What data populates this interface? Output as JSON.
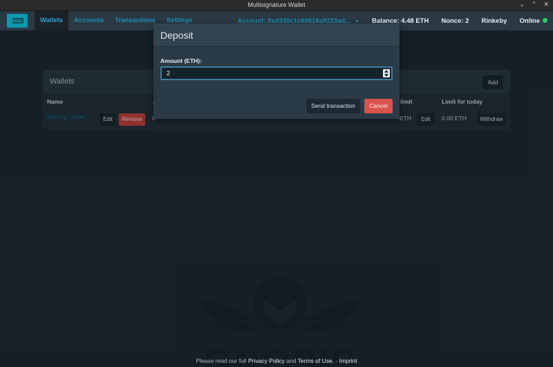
{
  "window": {
    "title": "Multisignature Wallet"
  },
  "navbar": {
    "tabs": [
      "Wallets",
      "Accounts",
      "Transactions",
      "Settings"
    ],
    "active_tab": "Wallets",
    "account": "Account: 0xd330c1c69818a9223ad...",
    "balance": "Balance: 4.48 ETH",
    "nonce": "Nonce: 2",
    "network": "Rinkeby",
    "status": "Online"
  },
  "wallets_panel": {
    "title": "Wallets",
    "add_label": "Add",
    "columns": {
      "name": "Name",
      "address": "A",
      "limit": "limit",
      "limit_today": "Limit for today"
    },
    "row": {
      "name": "Multisig_wallet",
      "edit_label": "Edit",
      "remove_label": "Remove",
      "address_fragment": "0",
      "limit_value": "ETH",
      "limit_edit_label": "Edit",
      "limit_today": "0.00 ETH",
      "withdraw_label": "Withdraw"
    }
  },
  "watermark": {
    "text": "GNOSIS"
  },
  "footer": {
    "prefix": "Please read our full",
    "privacy": "Privacy Policy",
    "and": "and",
    "terms": "Terms of Use.",
    "dash": "-",
    "imprint": "Imprint"
  },
  "modal": {
    "title": "Deposit",
    "amount_label": "Amount (ETH):",
    "amount_value": "2",
    "send_label": "Send transaction",
    "cancel_label": "Cancel"
  },
  "colors": {
    "online": "#2fc96a",
    "cancel": "#d9534f",
    "accent": "#1d8cb0"
  }
}
